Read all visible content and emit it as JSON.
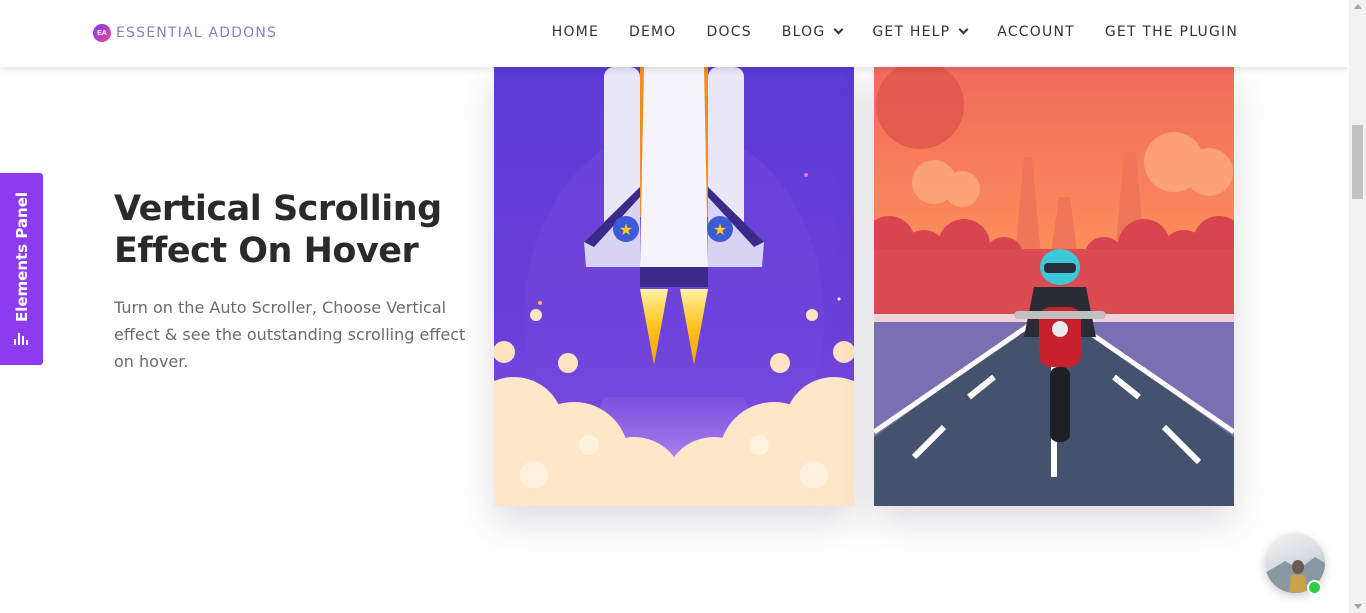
{
  "header": {
    "logo_mark": "EA",
    "logo_text": "ESSENTIAL ADDONS",
    "nav": [
      {
        "label": "HOME",
        "has_dropdown": false
      },
      {
        "label": "DEMO",
        "has_dropdown": false
      },
      {
        "label": "DOCS",
        "has_dropdown": false
      },
      {
        "label": "BLOG",
        "has_dropdown": true
      },
      {
        "label": "GET HELP",
        "has_dropdown": true
      },
      {
        "label": "ACCOUNT",
        "has_dropdown": false
      },
      {
        "label": "GET THE PLUGIN",
        "has_dropdown": false
      }
    ]
  },
  "elements_panel": {
    "label": "Elements Panel",
    "icon": "bar-chart-icon"
  },
  "section": {
    "heading": "Vertical Scrolling Effect On Hover",
    "description": "Turn on the Auto Scroller, Choose Vertical effect & see the outstanding scrolling effect on hover."
  },
  "cards": [
    {
      "image": "rocket-launch-illustration",
      "accent": "#5b3bd6"
    },
    {
      "image": "motorcycle-road-illustration",
      "accent": "#ef6a5a"
    }
  ],
  "chat": {
    "online": true,
    "status_color": "#2ecc40"
  },
  "colors": {
    "brand_purple": "#8d3bf0",
    "heading": "#2a2a2a",
    "body_text": "#6b6b6b"
  }
}
